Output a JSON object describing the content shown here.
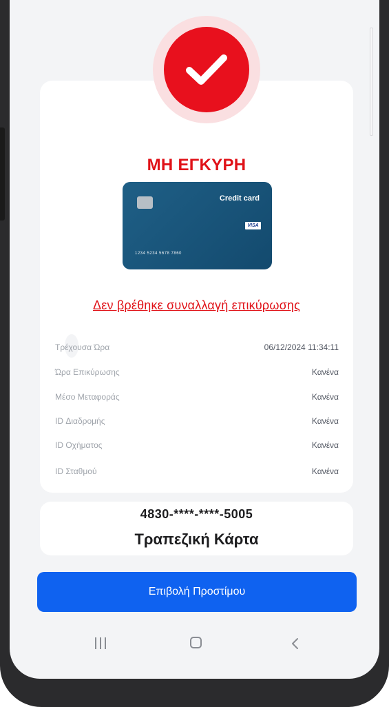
{
  "status": {
    "title": "ΜΗ ΕΓΚΥΡΗ",
    "icon": "check-circle-icon",
    "accent_color": "#e8101d"
  },
  "credit_card": {
    "title": "Credit card",
    "brand": "VISA",
    "number": "1234 5234 5678 7860"
  },
  "message": "Δεν βρέθηκε συναλλαγή επικύρωσης",
  "details": [
    {
      "label": "Τρέχουσα Ώρα",
      "value": "06/12/2024 11:34:11"
    },
    {
      "label": "Ώρα Επικύρωσης",
      "value": "Κανένα"
    },
    {
      "label": "Μέσο Μεταφοράς",
      "value": "Κανένα"
    },
    {
      "label": "ID Διαδρομής",
      "value": "Κανένα"
    },
    {
      "label": "ID Οχήματος",
      "value": "Κανένα"
    },
    {
      "label": "ID Σταθμού",
      "value": "Κανένα"
    }
  ],
  "card_info": {
    "masked_number": "4830-****-****-5005",
    "type": "Τραπεζική Κάρτα"
  },
  "action": {
    "label": "Επιβολή Προστίμου",
    "color": "#0f62f0"
  },
  "navbar": {
    "recents": "recents-icon",
    "home": "home-icon",
    "back": "back-icon"
  }
}
